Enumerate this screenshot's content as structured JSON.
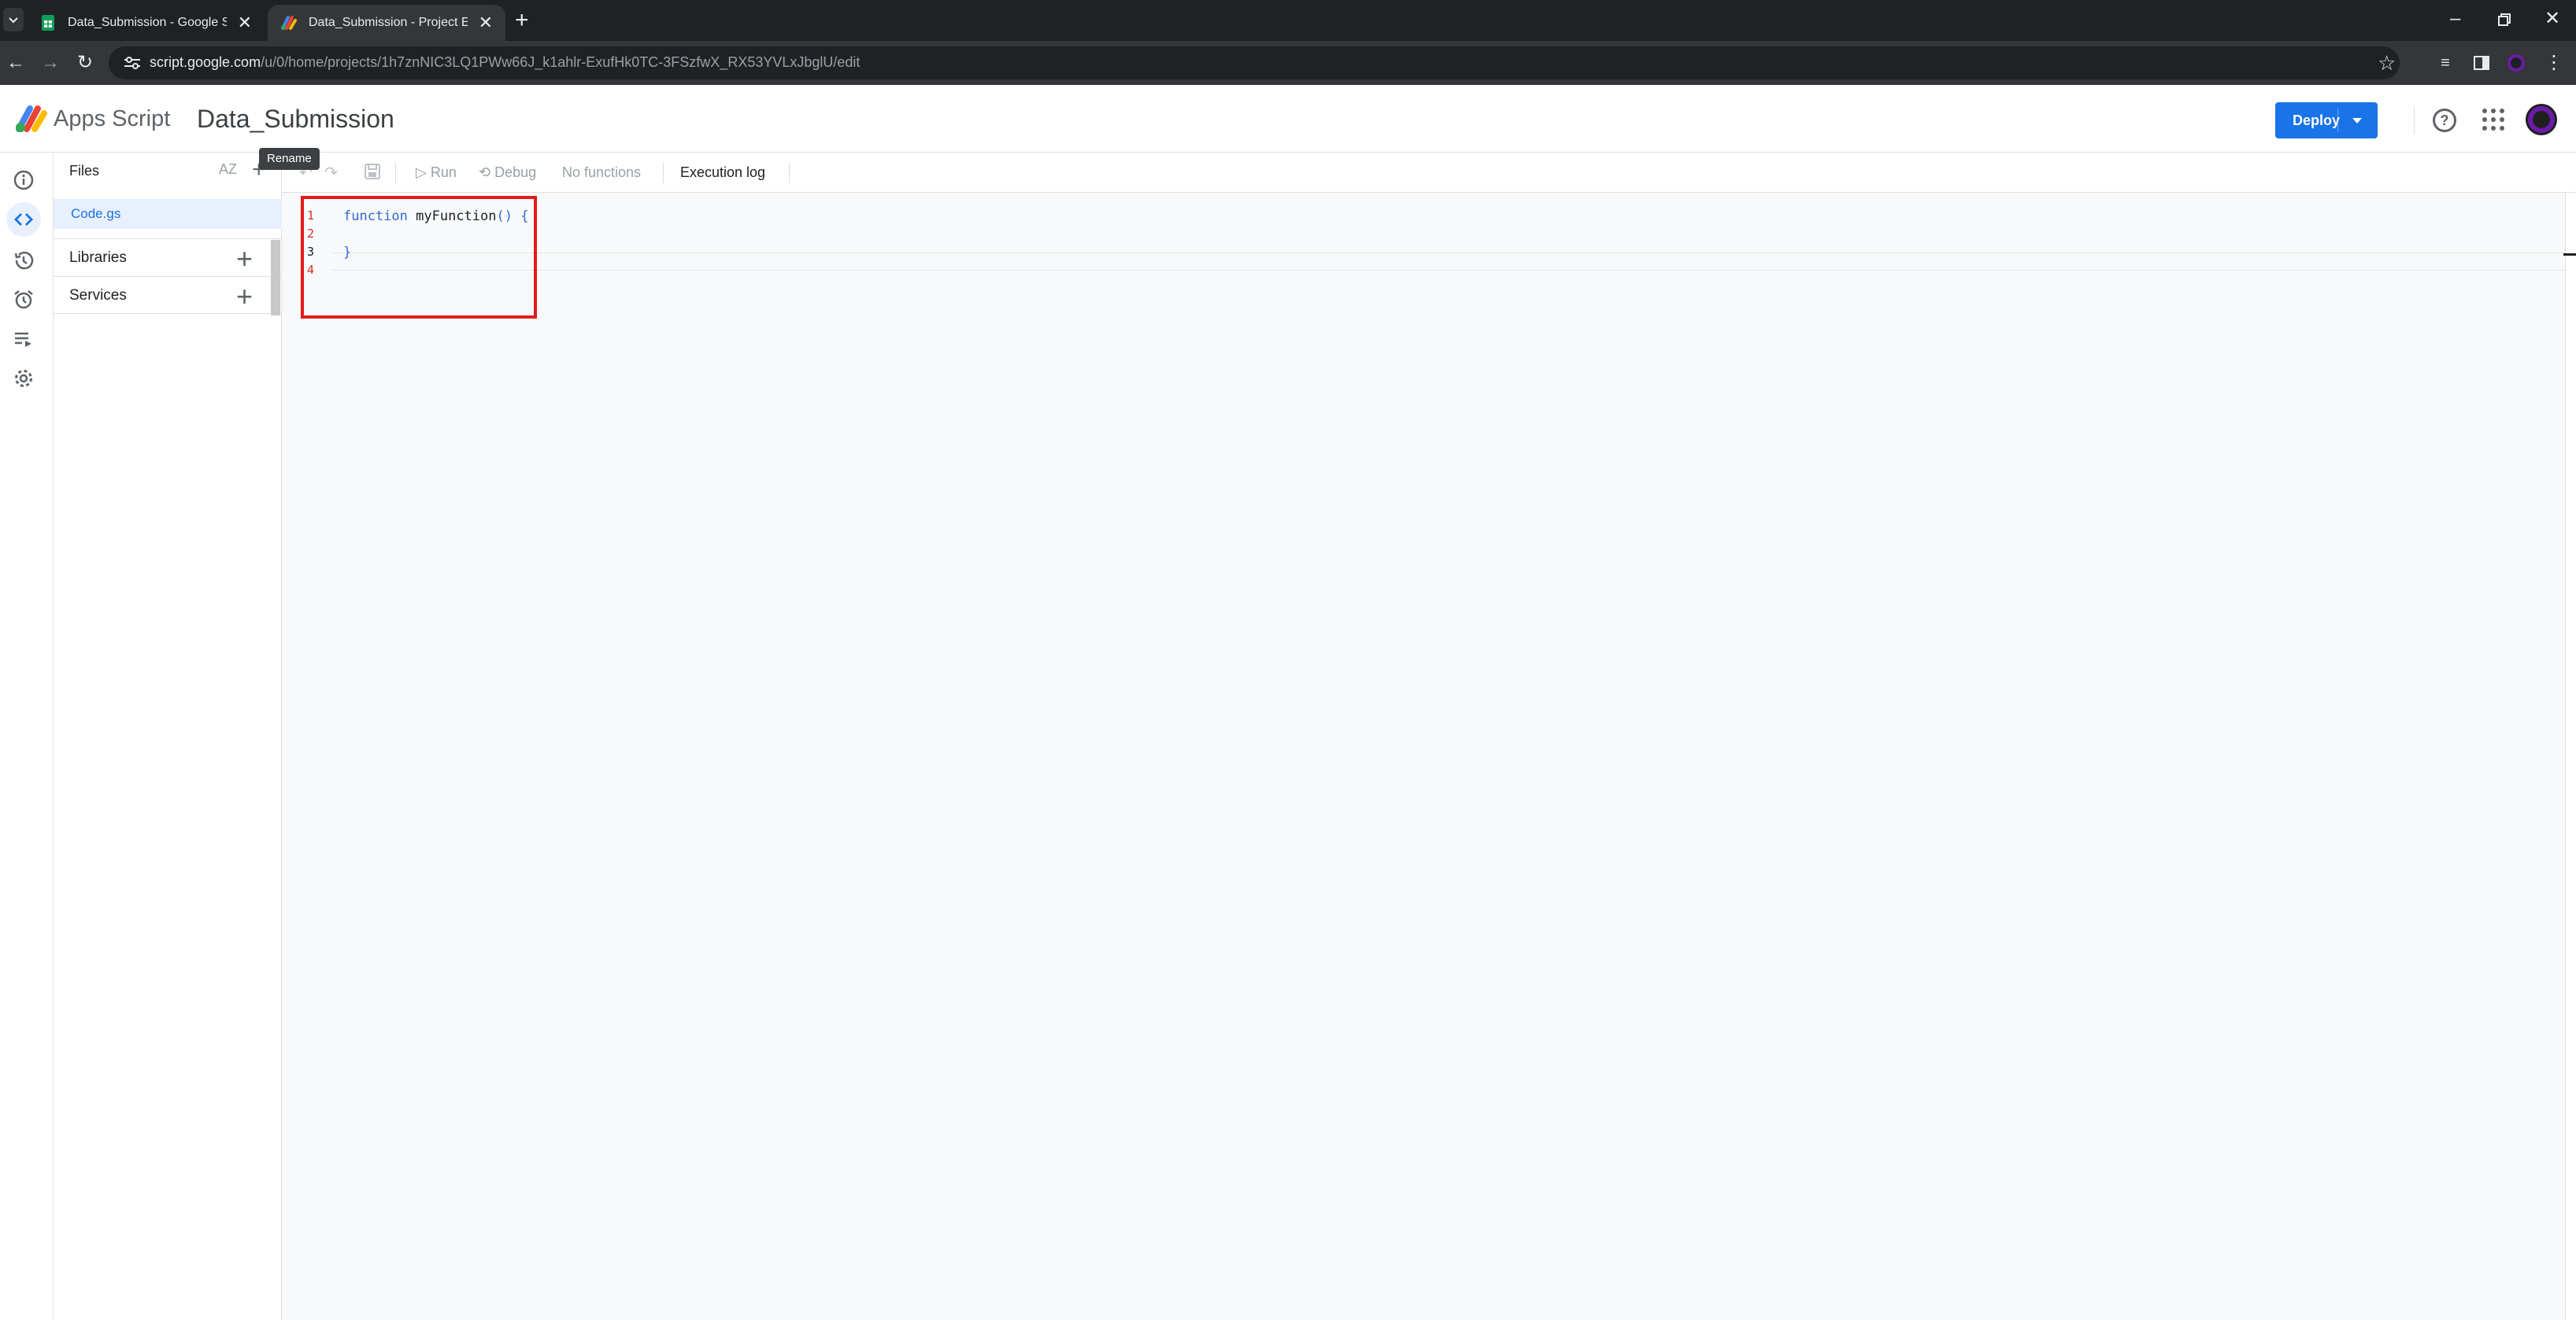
{
  "browser": {
    "tabs": [
      {
        "title": "Data_Submission - Google She",
        "close": "✕",
        "icon": "google-sheets-icon"
      },
      {
        "title": "Data_Submission - Project Edit",
        "close": "✕",
        "icon": "apps-script-icon"
      }
    ],
    "new_tab": "+",
    "url_host": "script.google.com",
    "url_path": "/u/0/home/projects/1h7znNIC3LQ1PWw66J_k1ahlr-ExufHk0TC-3FSzfwX_RX53YVLxJbglU/edit"
  },
  "header": {
    "app_name": "Apps Script",
    "project_title": "Data_Submission",
    "deploy_label": "Deploy"
  },
  "files_panel": {
    "title": "Files",
    "sort_label": "AZ",
    "files": [
      {
        "name": "Code.gs"
      }
    ],
    "sections": [
      {
        "label": "Libraries"
      },
      {
        "label": "Services"
      }
    ],
    "tooltip": "Rename"
  },
  "toolbar": {
    "run_label": "Run",
    "debug_label": "Debug",
    "function_select": "No functions",
    "execution_log_label": "Execution log"
  },
  "editor": {
    "line_numbers": [
      "1",
      "2",
      "3",
      "4"
    ],
    "current_line": "3",
    "code": {
      "line1_keyword": "function",
      "line1_name": "myFunction",
      "line1_parens": "()",
      "line1_brace": "{",
      "line3_brace": "}"
    }
  },
  "colors": {
    "accent": "#1a73e8",
    "highlight_box": "#e31b1b",
    "chrome_dark": "#202124"
  }
}
